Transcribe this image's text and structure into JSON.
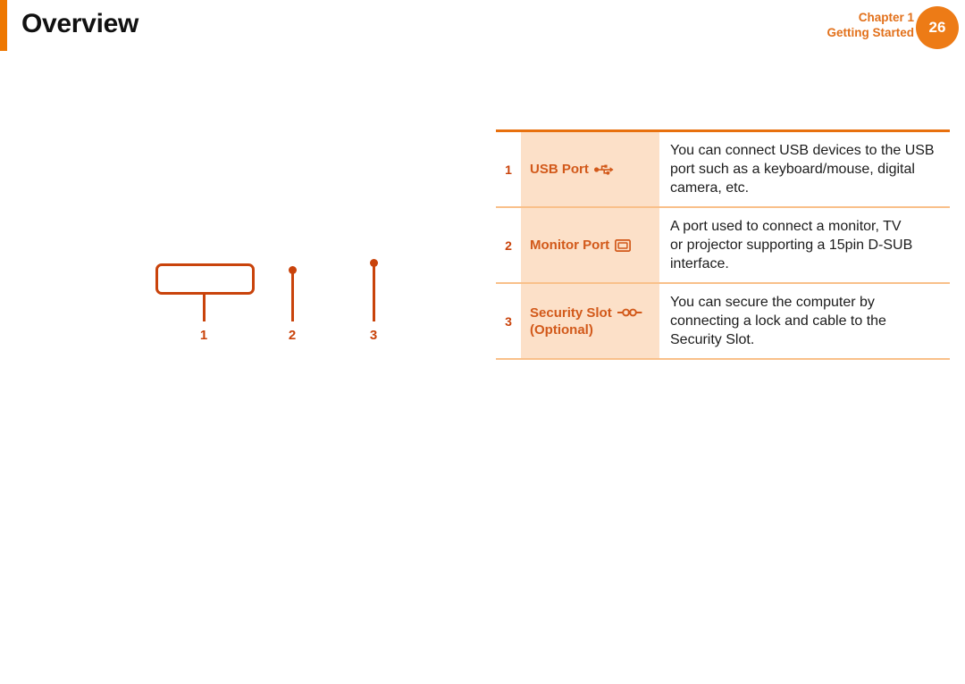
{
  "header": {
    "title": "Overview",
    "chapter": "Chapter 1",
    "section": "Getting Started",
    "page_number": "26",
    "accent_color": "#ee7700",
    "chapter_text_color": "#e2701a",
    "badge_color": "#ed7b16"
  },
  "diagram": {
    "callouts": [
      {
        "number": "1",
        "marker": "rounded-rectangle-outline"
      },
      {
        "number": "2",
        "marker": "dot"
      },
      {
        "number": "3",
        "marker": "dot"
      }
    ],
    "line_color": "#c9430b"
  },
  "spec_table": {
    "top_rule_color": "#e8700e",
    "row_rule_color": "#f9c08a",
    "label_cell_background": "#fce0c8",
    "label_text_color": "#d2591a",
    "rows": [
      {
        "number": "1",
        "label": "USB Port",
        "label_extra": "",
        "icon": "usb-icon",
        "description_lines": [
          "You can connect USB devices to the USB",
          "port such as a keyboard/mouse, digital",
          "camera, etc."
        ]
      },
      {
        "number": "2",
        "label": "Monitor Port",
        "label_extra": "",
        "icon": "monitor-port-icon",
        "description_lines": [
          "A port used to connect a monitor, TV",
          "or projector supporting a 15pin D-SUB",
          "interface."
        ]
      },
      {
        "number": "3",
        "label": "Security Slot",
        "label_extra": "(Optional)",
        "icon": "security-slot-chain-icon",
        "description_lines": [
          "You can secure the computer by",
          "connecting a lock and cable to the",
          "Security Slot."
        ]
      }
    ]
  }
}
